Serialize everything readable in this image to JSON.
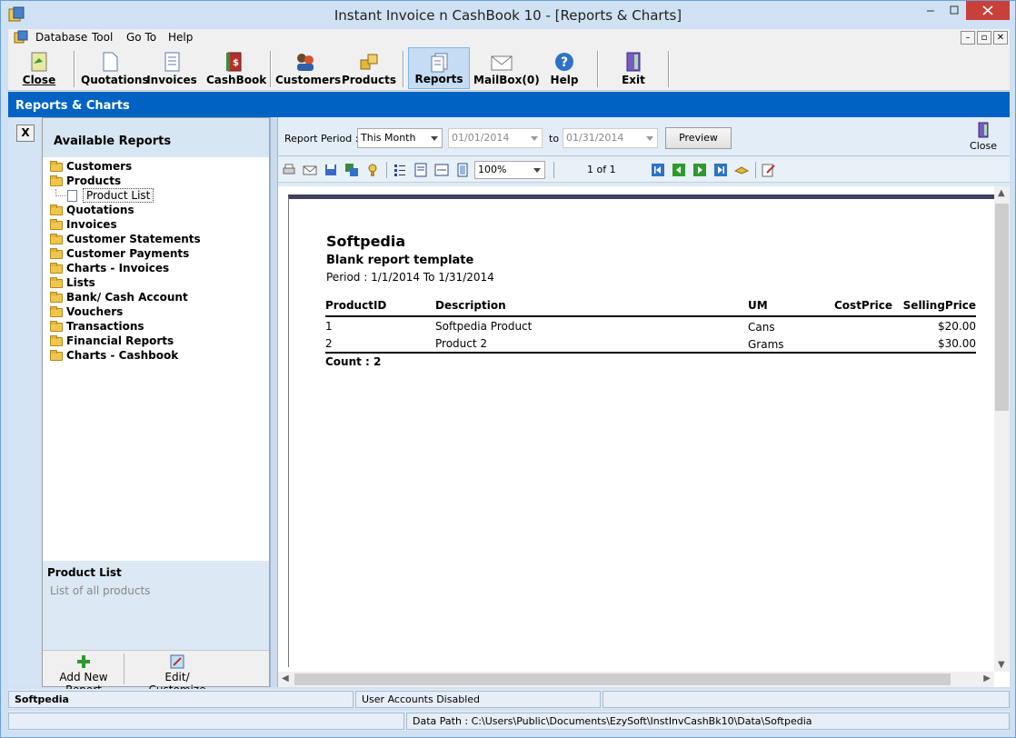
{
  "window": {
    "title": "Instant Invoice n CashBook 10 - [Reports & Charts]"
  },
  "menu": {
    "items": [
      "Database",
      "Tool",
      "Go To",
      "Help"
    ]
  },
  "toolbar": {
    "buttons": [
      {
        "label": "Close",
        "icon": "close-door-icon"
      },
      {
        "label": "Quotations",
        "icon": "document-icon"
      },
      {
        "label": "Invoices",
        "icon": "invoice-icon"
      },
      {
        "label": "CashBook",
        "icon": "cashbook-icon"
      },
      {
        "label": "Customers",
        "icon": "customers-icon"
      },
      {
        "label": "Products",
        "icon": "products-icon"
      },
      {
        "label": "Reports",
        "icon": "reports-icon"
      },
      {
        "label": "MailBox(0)",
        "icon": "mail-icon"
      },
      {
        "label": "Help",
        "icon": "help-icon"
      },
      {
        "label": "Exit",
        "icon": "exit-icon"
      }
    ],
    "active": "Reports"
  },
  "section": {
    "title": "Reports & Charts"
  },
  "left_strip": {
    "close_label": "X"
  },
  "reports_panel": {
    "header": "Available Reports",
    "tree": [
      {
        "label": "Customers"
      },
      {
        "label": "Products",
        "children": [
          "Product List"
        ]
      },
      {
        "label": "Quotations"
      },
      {
        "label": "Invoices"
      },
      {
        "label": "Customer Statements"
      },
      {
        "label": "Customer Payments"
      },
      {
        "label": "Charts - Invoices"
      },
      {
        "label": "Lists"
      },
      {
        "label": "Bank/ Cash Account"
      },
      {
        "label": "Vouchers"
      },
      {
        "label": "Transactions"
      },
      {
        "label": "Financial Reports"
      },
      {
        "label": "Charts - Cashbook"
      }
    ],
    "selected": "Product List",
    "description_title": "Product List",
    "description_text": "List of all products",
    "add_button": "Add New Report",
    "edit_button": "Edit/ Customize"
  },
  "period": {
    "label": "Report Period :",
    "selected": "This Month",
    "from": "01/01/2014",
    "to_label": "to",
    "to": "01/31/2014",
    "preview_label": "Preview",
    "close_label": "Close"
  },
  "viewer": {
    "zoom": "100%",
    "page_indicator": "1 of 1"
  },
  "report": {
    "company": "Softpedia",
    "template": "Blank report template",
    "period_text": "Period : 1/1/2014 To 1/31/2014",
    "columns": [
      "ProductID",
      "Description",
      "UM",
      "CostPrice",
      "SellingPrice"
    ],
    "rows": [
      {
        "id": "1",
        "description": "Softpedia Product",
        "um": "Cans",
        "cost": "",
        "selling": "$20.00"
      },
      {
        "id": "2",
        "description": "Product 2",
        "um": "Grams",
        "cost": "",
        "selling": "$30.00"
      }
    ],
    "count": "Count : 2"
  },
  "status": {
    "company": "Softpedia",
    "accounts": "User Accounts Disabled",
    "data_path": "Data Path : C:\\Users\\Public\\Documents\\EzySoft\\InstInvCashBk10\\Data\\Softpedia"
  },
  "colors": {
    "header_blue": "#0063c3",
    "active_tab": "#c5dcf2",
    "title_close": "#c7403a"
  }
}
